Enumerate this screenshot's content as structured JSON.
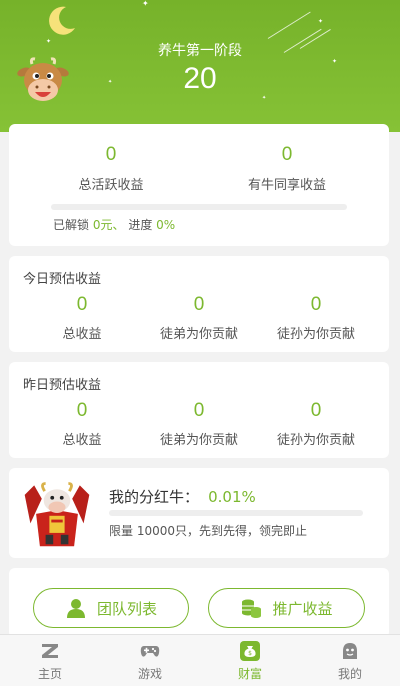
{
  "hero": {
    "stage_label": "养牛第一阶段",
    "stage_value": "20"
  },
  "summary": {
    "total_active_value": "0",
    "total_active_label": "总活跃收益",
    "shared_value": "0",
    "shared_label": "有牛同享收益",
    "unlocked_prefix": "已解锁",
    "unlocked_amount": "0元、",
    "progress_prefix": "进度",
    "progress_value": "0%",
    "progress_fraction": 0
  },
  "today": {
    "title": "今日预估收益",
    "items": [
      {
        "value": "0",
        "label": "总收益"
      },
      {
        "value": "0",
        "label": "徒弟为你贡献"
      },
      {
        "value": "0",
        "label": "徒孙为你贡献"
      }
    ]
  },
  "yesterday": {
    "title": "昨日预估收益",
    "items": [
      {
        "value": "0",
        "label": "总收益"
      },
      {
        "value": "0",
        "label": "徒弟为你贡献"
      },
      {
        "value": "0",
        "label": "徒孙为你贡献"
      }
    ]
  },
  "dividend": {
    "label": "我的分红牛：",
    "value": "0.01%",
    "progress_fraction": 0,
    "note": "限量 10000只，先到先得，领完即止"
  },
  "actions": {
    "team_list": "团队列表",
    "promo_income": "推广收益"
  },
  "tabs": [
    {
      "label": "主页",
      "icon": "z-logo-icon"
    },
    {
      "label": "游戏",
      "icon": "gamepad-icon"
    },
    {
      "label": "财富",
      "icon": "money-bag-icon",
      "active": true
    },
    {
      "label": "我的",
      "icon": "ghost-profile-icon"
    }
  ],
  "colors": {
    "accent": "#7cb82f",
    "hero_top": "#76b22a",
    "hero_bottom": "#86c236",
    "background": "#f2f2f2"
  }
}
